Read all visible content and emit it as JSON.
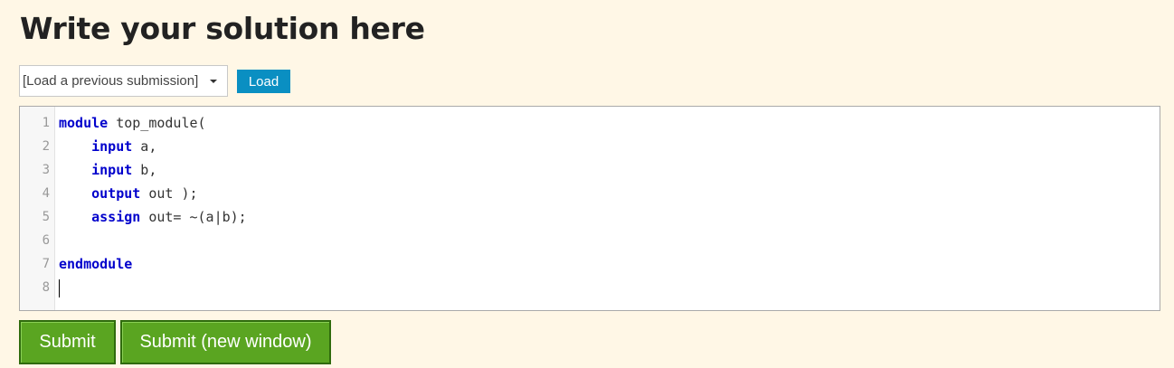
{
  "heading": "Write your solution here",
  "submission_select": {
    "selected": "[Load a previous submission]"
  },
  "load_button": "Load",
  "editor": {
    "lines": [
      {
        "number": "1",
        "keyword": "module",
        "rest": " top_module("
      },
      {
        "number": "2",
        "keyword": "    input",
        "rest": " a,"
      },
      {
        "number": "3",
        "keyword": "    input",
        "rest": " b,"
      },
      {
        "number": "4",
        "keyword": "    output",
        "rest": " out );"
      },
      {
        "number": "5",
        "keyword": "    assign",
        "rest": " out= ~(a|b);"
      },
      {
        "number": "6",
        "keyword": "",
        "rest": ""
      },
      {
        "number": "7",
        "keyword": "endmodule",
        "rest": ""
      },
      {
        "number": "8",
        "keyword": "",
        "rest": ""
      }
    ]
  },
  "submit_button": "Submit",
  "submit_new_window_button": "Submit (new window)",
  "colors": {
    "background": "#fff7e6",
    "load_button": "#0a8fc2",
    "submit_button": "#5aa521",
    "keyword": "#0000cc"
  }
}
